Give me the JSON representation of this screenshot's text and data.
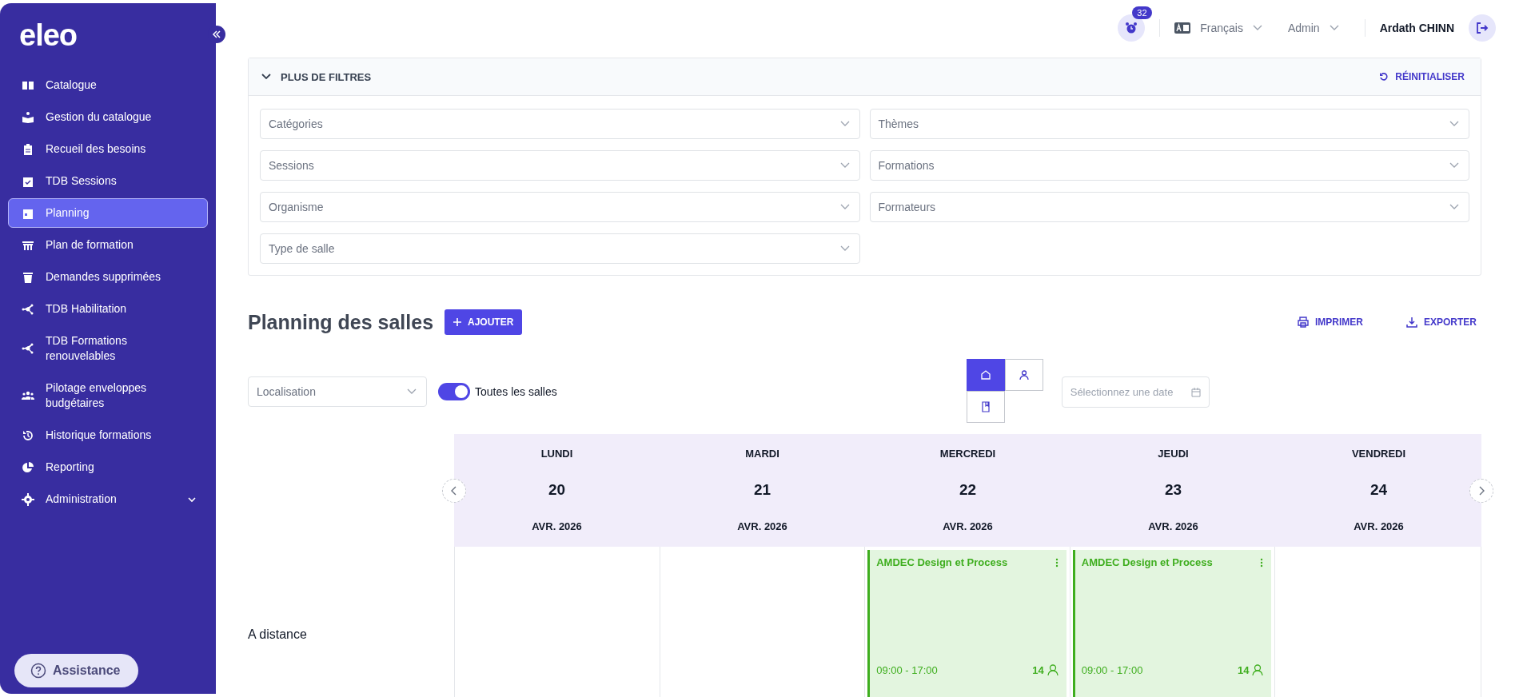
{
  "sidebar": {
    "logo": "eleo",
    "items": [
      {
        "label": "Catalogue",
        "selected": false
      },
      {
        "label": "Gestion du catalogue",
        "selected": false
      },
      {
        "label": "Recueil des besoins",
        "selected": false
      },
      {
        "label": "TDB Sessions",
        "selected": false
      },
      {
        "label": "Planning",
        "selected": true
      },
      {
        "label": "Plan de formation",
        "selected": false
      },
      {
        "label": "Demandes supprimées",
        "selected": false
      },
      {
        "label": "TDB Habilitation",
        "selected": false
      },
      {
        "label": "TDB Formations renouvelables",
        "selected": false
      },
      {
        "label": "Pilotage enveloppes budgétaires",
        "selected": false
      },
      {
        "label": "Historique formations",
        "selected": false
      },
      {
        "label": "Reporting",
        "selected": false
      },
      {
        "label": "Administration",
        "selected": false,
        "expanded": false
      }
    ],
    "assistance": "Assistance"
  },
  "header": {
    "notification_count": "32",
    "language": "Français",
    "role": "Admin",
    "user": "Ardath CHINN"
  },
  "filters": {
    "title": "PLUS DE FILTRES",
    "expanded": true,
    "reset": "RÉINITIALISER",
    "fields": [
      {
        "placeholder": "Catégories"
      },
      {
        "placeholder": "Thèmes"
      },
      {
        "placeholder": "Sessions"
      },
      {
        "placeholder": "Formations"
      },
      {
        "placeholder": "Organisme"
      },
      {
        "placeholder": "Formateurs"
      },
      {
        "placeholder": "Type de salle"
      }
    ]
  },
  "planning": {
    "title": "Planning des salles",
    "add_button": "AJOUTER",
    "actions": [
      {
        "kind": "print",
        "label": "IMPRIMER"
      },
      {
        "kind": "export",
        "label": "EXPORTER"
      }
    ],
    "location": {
      "placeholder": "Localisation"
    },
    "toggle": {
      "label": "Toutes les salles",
      "on": true
    },
    "views": [
      {
        "kind": "home",
        "selected": true
      },
      {
        "kind": "person",
        "selected": false
      },
      {
        "kind": "book",
        "selected": false
      }
    ],
    "date": {
      "placeholder": "Sélectionnez une date"
    }
  },
  "calendar": {
    "days": [
      {
        "weekday": "LUNDI",
        "day": "20",
        "month": "AVR. 2026"
      },
      {
        "weekday": "MARDI",
        "day": "21",
        "month": "AVR. 2026"
      },
      {
        "weekday": "MERCREDI",
        "day": "22",
        "month": "AVR. 2026"
      },
      {
        "weekday": "JEUDI",
        "day": "23",
        "month": "AVR. 2026"
      },
      {
        "weekday": "VENDREDI",
        "day": "24",
        "month": "AVR. 2026"
      }
    ],
    "rows": [
      {
        "label": "A distance",
        "cells": [
          {},
          {},
          {
            "title": "AMDEC Design et Process",
            "time": "09:00 - 17:00",
            "count": "14"
          },
          {
            "title": "AMDEC Design et Process",
            "time": "09:00 - 17:00",
            "count": "14"
          },
          {}
        ]
      }
    ]
  }
}
